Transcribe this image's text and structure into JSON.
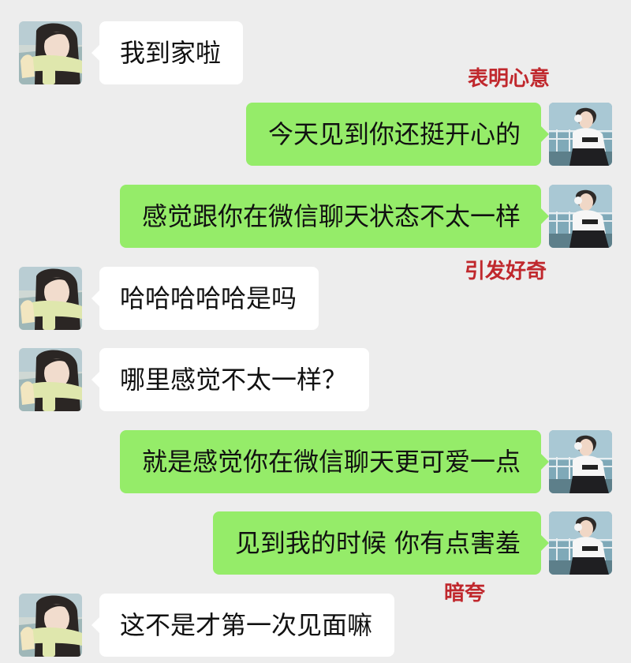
{
  "chat": {
    "messages": [
      {
        "side": "left",
        "text": "我到家啦"
      },
      {
        "side": "right",
        "text": "今天见到你还挺开心的"
      },
      {
        "side": "right",
        "text": "感觉跟你在微信聊天状态不太一样"
      },
      {
        "side": "left",
        "text": "哈哈哈哈哈是吗"
      },
      {
        "side": "left",
        "text": "哪里感觉不太一样？"
      },
      {
        "side": "right",
        "text": "就是感觉你在微信聊天更可爱一点"
      },
      {
        "side": "right",
        "text": "见到我的时候 你有点害羞"
      },
      {
        "side": "left",
        "text": "这不是才第一次见面嘛"
      }
    ],
    "annotations": [
      "表明心意",
      "引发好奇",
      "暗夸"
    ],
    "colors": {
      "background": "#ededed",
      "incoming_bubble": "#ffffff",
      "outgoing_bubble": "#95ec69",
      "annotation": "#c0282d"
    },
    "avatars": {
      "left": "girl-with-scarf-avatar-icon",
      "right": "boy-with-headphones-avatar-icon"
    }
  }
}
